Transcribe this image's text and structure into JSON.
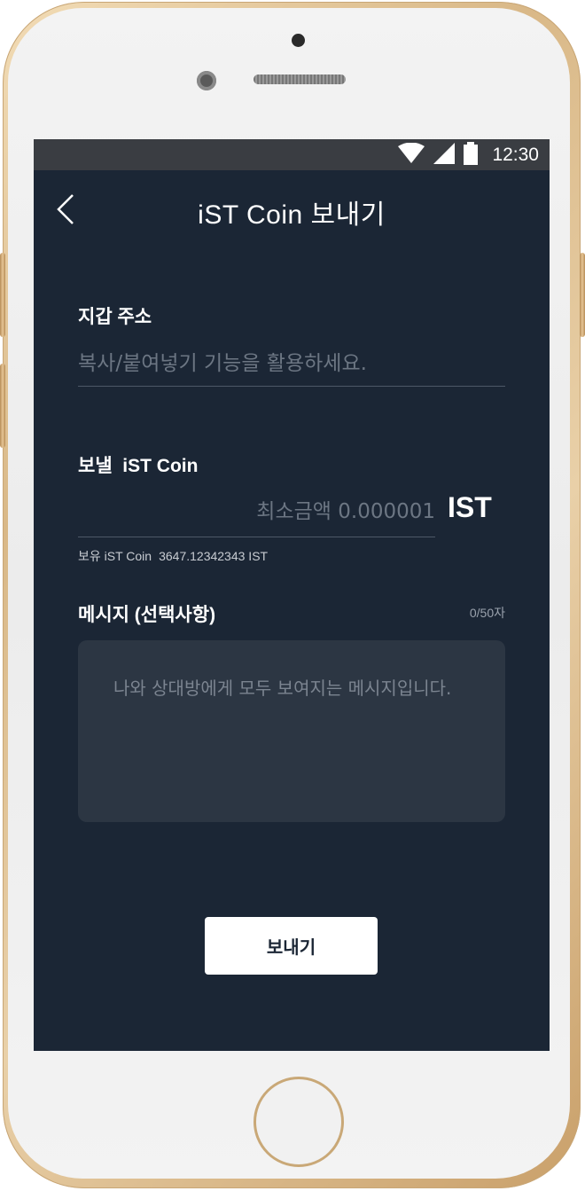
{
  "status_bar": {
    "time": "12:30"
  },
  "header": {
    "title": "iST Coin 보내기"
  },
  "wallet": {
    "label": "지갑 주소",
    "placeholder": "복사/붙여넣기 기능을 활용하세요."
  },
  "amount": {
    "label": "보낼  iST Coin",
    "placeholder": "최소금액 0.000001",
    "unit": "IST",
    "balance_label": "보유 iST Coin",
    "balance_value": "3647.12342343 IST"
  },
  "message": {
    "label": "메시지 (선택사항)",
    "count": "0/50자",
    "placeholder": "나와 상대방에게 모두 보여지는 메시지입니다."
  },
  "send_button": {
    "label": "보내기"
  },
  "icons": {
    "back": "chevron-left-icon",
    "wifi": "wifi-icon",
    "signal": "signal-icon",
    "battery": "battery-icon"
  },
  "colors": {
    "screen_bg": "#1b2635",
    "status_bar_bg": "#3a3d42",
    "textarea_bg": "#2c3643",
    "button_bg": "#ffffff"
  }
}
